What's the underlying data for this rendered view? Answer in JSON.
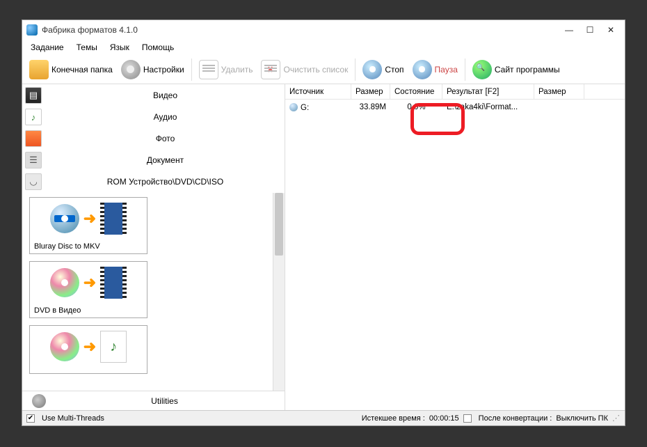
{
  "title": "Фабрика форматов 4.1.0",
  "menu": {
    "task": "Задание",
    "themes": "Темы",
    "lang": "Язык",
    "help": "Помощь"
  },
  "toolbar": {
    "outfolder": "Конечная папка",
    "settings": "Настройки",
    "delete": "Удалить",
    "clear": "Очистить список",
    "stop": "Стоп",
    "pause": "Пауза",
    "website": "Сайт программы"
  },
  "categories": {
    "video": "Видео",
    "audio": "Аудио",
    "photo": "Фото",
    "document": "Документ",
    "rom": "ROM Устройство\\DVD\\CD\\ISO"
  },
  "presets": {
    "p1": "Bluray Disc to MKV",
    "p2": "DVD в Видео",
    "p3": ""
  },
  "utilities": "Utilities",
  "columns": {
    "source": "Источник",
    "size": "Размер",
    "state": "Состояние",
    "result": "Результат [F2]",
    "size2": "Размер"
  },
  "row": {
    "source": "G:",
    "size": "33.89M",
    "state": "0.0%",
    "result": "E:\\zaka4ki\\Format...",
    "size2": ""
  },
  "status": {
    "multithread": "Use Multi-Threads",
    "elapsed_label": "Истекшее время :",
    "elapsed_value": "00:00:15",
    "after_label": "После конвертации :",
    "after_action": "Выключить ПК"
  }
}
